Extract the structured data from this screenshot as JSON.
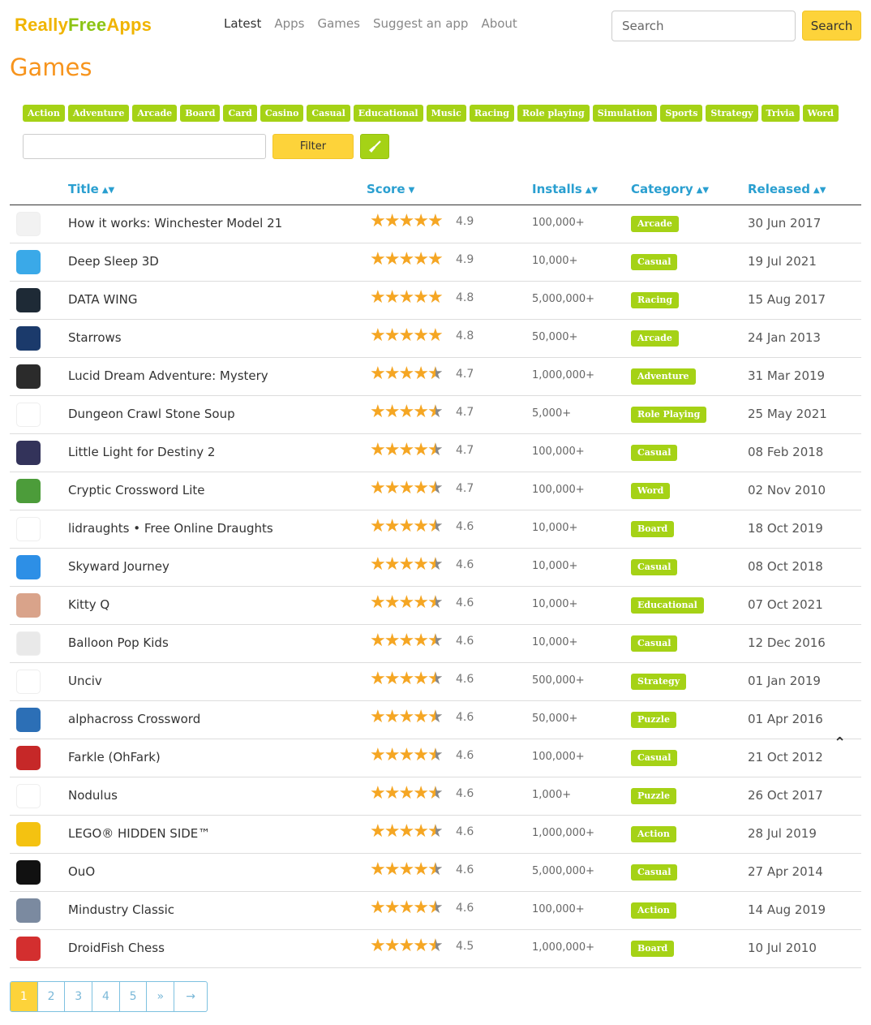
{
  "header": {
    "logo": [
      "Really",
      "Free",
      "Apps"
    ],
    "nav": [
      "Latest",
      "Apps",
      "Games",
      "Suggest an app",
      "About"
    ],
    "search_placeholder": "Search",
    "search_button": "Search"
  },
  "page_title": "Games",
  "tags": [
    "Action",
    "Adventure",
    "Arcade",
    "Board",
    "Card",
    "Casino",
    "Casual",
    "Educational",
    "Music",
    "Racing",
    "Role playing",
    "Simulation",
    "Sports",
    "Strategy",
    "Trivia",
    "Word"
  ],
  "filter": {
    "button": "Filter"
  },
  "columns": {
    "title": "Title",
    "score": "Score",
    "installs": "Installs",
    "category": "Category",
    "released": "Released"
  },
  "colors": {
    "accent_yellow": "#fdd33a",
    "accent_green": "#a5d216",
    "title_orange": "#f7941d",
    "link_blue": "#2a9fd0",
    "star": "#f5a623"
  },
  "rows": [
    {
      "title": "How it works: Winchester Model 21",
      "score": "4.9",
      "installs": "100,000+",
      "category": "Arcade",
      "released": "30 Jun 2017",
      "icon": "rifle-icon",
      "icon_color": "#f2f2f2"
    },
    {
      "title": "Deep Sleep 3D",
      "score": "4.9",
      "installs": "10,000+",
      "category": "Casual",
      "released": "19 Jul 2021",
      "icon": "sleep-icon",
      "icon_color": "#3aa9e8"
    },
    {
      "title": "DATA WING",
      "score": "4.8",
      "installs": "5,000,000+",
      "category": "Racing",
      "released": "15 Aug 2017",
      "icon": "wing-icon",
      "icon_color": "#1e2a36"
    },
    {
      "title": "Starrows",
      "score": "4.8",
      "installs": "50,000+",
      "category": "Arcade",
      "released": "24 Jan 2013",
      "icon": "starrows-icon",
      "icon_color": "#1b3a6b"
    },
    {
      "title": "Lucid Dream Adventure: Mystery",
      "score": "4.7",
      "installs": "1,000,000+",
      "category": "Adventure",
      "released": "31 Mar 2019",
      "icon": "dream-icon",
      "icon_color": "#2b2b2b"
    },
    {
      "title": "Dungeon Crawl Stone Soup",
      "score": "4.7",
      "installs": "5,000+",
      "category": "Role Playing",
      "released": "25 May 2021",
      "icon": "cauldron-icon",
      "icon_color": "#ffffff"
    },
    {
      "title": "Little Light for Destiny 2",
      "score": "4.7",
      "installs": "100,000+",
      "category": "Casual",
      "released": "08 Feb 2018",
      "icon": "ghost-icon",
      "icon_color": "#33335a"
    },
    {
      "title": "Cryptic Crossword Lite",
      "score": "4.7",
      "installs": "100,000+",
      "category": "Word",
      "released": "02 Nov 2010",
      "icon": "crossword-icon",
      "icon_color": "#4c9c3a"
    },
    {
      "title": "lidraughts • Free Online Draughts",
      "score": "4.6",
      "installs": "10,000+",
      "category": "Board",
      "released": "18 Oct 2019",
      "icon": "draughts-icon",
      "icon_color": "#ffffff"
    },
    {
      "title": "Skyward Journey",
      "score": "4.6",
      "installs": "10,000+",
      "category": "Casual",
      "released": "08 Oct 2018",
      "icon": "plane-icon",
      "icon_color": "#2d8fe6"
    },
    {
      "title": "Kitty Q",
      "score": "4.6",
      "installs": "10,000+",
      "category": "Educational",
      "released": "07 Oct 2021",
      "icon": "kitty-icon",
      "icon_color": "#d9a38a"
    },
    {
      "title": "Balloon Pop Kids",
      "score": "4.6",
      "installs": "10,000+",
      "category": "Casual",
      "released": "12 Dec 2016",
      "icon": "balloon-icon",
      "icon_color": "#e9e9e9"
    },
    {
      "title": "Unciv",
      "score": "4.6",
      "installs": "500,000+",
      "category": "Strategy",
      "released": "01 Jan 2019",
      "icon": "hex-icon",
      "icon_color": "#ffffff"
    },
    {
      "title": "alphacross Crossword",
      "score": "4.6",
      "installs": "50,000+",
      "category": "Puzzle",
      "released": "01 Apr 2016",
      "icon": "pencil-icon",
      "icon_color": "#2c6fb6"
    },
    {
      "title": "Farkle (OhFark)",
      "score": "4.6",
      "installs": "100,000+",
      "category": "Casual",
      "released": "21 Oct 2012",
      "icon": "dice-icon",
      "icon_color": "#c62828"
    },
    {
      "title": "Nodulus",
      "score": "4.6",
      "installs": "1,000+",
      "category": "Puzzle",
      "released": "26 Oct 2017",
      "icon": "nodes-icon",
      "icon_color": "#ffffff"
    },
    {
      "title": "LEGO® HIDDEN SIDE™",
      "score": "4.6",
      "installs": "1,000,000+",
      "category": "Action",
      "released": "28 Jul 2019",
      "icon": "lego-icon",
      "icon_color": "#f4c211"
    },
    {
      "title": "OuO",
      "score": "4.6",
      "installs": "5,000,000+",
      "category": "Casual",
      "released": "27 Apr 2014",
      "icon": "dot-icon",
      "icon_color": "#111111"
    },
    {
      "title": "Mindustry Classic",
      "score": "4.6",
      "installs": "100,000+",
      "category": "Action",
      "released": "14 Aug 2019",
      "icon": "mech-icon",
      "icon_color": "#7b8aa0"
    },
    {
      "title": "DroidFish Chess",
      "score": "4.5",
      "installs": "1,000,000+",
      "category": "Board",
      "released": "10 Jul 2010",
      "icon": "chess-icon",
      "icon_color": "#d32f2f"
    }
  ],
  "pagination": [
    "1",
    "2",
    "3",
    "4",
    "5",
    "»",
    "→"
  ],
  "back_to_top": "⌃"
}
